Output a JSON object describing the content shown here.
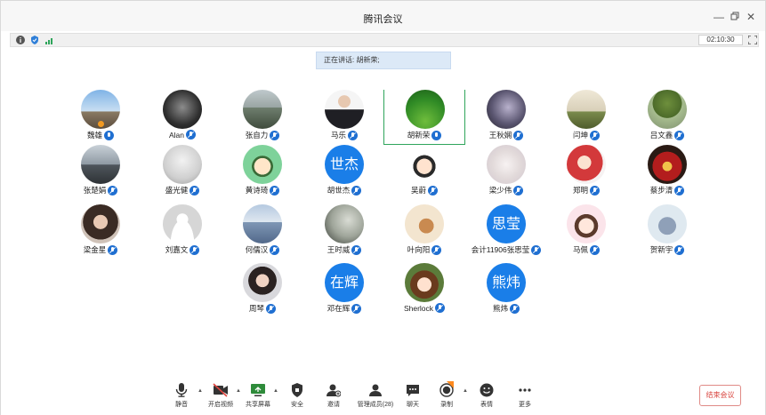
{
  "window": {
    "title": "腾讯会议"
  },
  "status": {
    "timer": "02:10:30"
  },
  "banner": {
    "speaking": "正在讲话: 胡新荣;"
  },
  "participants": [
    {
      "name": "魏雄",
      "avatar": "photo-sky",
      "mic": "on",
      "hand": true
    },
    {
      "name": "Alan",
      "avatar": "photo-dark",
      "mic": "muted"
    },
    {
      "name": "张自力",
      "avatar": "photo-road",
      "mic": "muted"
    },
    {
      "name": "马乐",
      "avatar": "photo-suit",
      "mic": "muted"
    },
    {
      "name": "胡新荣",
      "avatar": "photo-green",
      "mic": "on",
      "active": true
    },
    {
      "name": "王秋娴",
      "avatar": "photo-anime",
      "mic": "muted"
    },
    {
      "name": "闫坤",
      "avatar": "photo-field",
      "mic": "muted"
    },
    {
      "name": "吕文鑫",
      "avatar": "photo-tree",
      "mic": "muted"
    },
    {
      "name": "张楚娟",
      "avatar": "photo-mountain",
      "mic": "muted"
    },
    {
      "name": "盛光健",
      "avatar": "photo-sketch",
      "mic": "muted"
    },
    {
      "name": "黄诗琦",
      "avatar": "photo-cartoon-boy",
      "mic": "muted"
    },
    {
      "name": "胡世杰",
      "avatar": "text",
      "avatar_text": "世杰",
      "mic": "muted"
    },
    {
      "name": "吴蔚",
      "avatar": "photo-cartoon-girl",
      "mic": "muted"
    },
    {
      "name": "梁少伟",
      "avatar": "photo-white-hair",
      "mic": "muted"
    },
    {
      "name": "郑明",
      "avatar": "photo-mermaid",
      "mic": "muted"
    },
    {
      "name": "蔡步清",
      "avatar": "photo-ironman",
      "mic": "muted"
    },
    {
      "name": "梁金星",
      "avatar": "photo-girl",
      "mic": "muted"
    },
    {
      "name": "刘嘉文",
      "avatar": "photo-default",
      "mic": "muted"
    },
    {
      "name": "何儒汉",
      "avatar": "photo-clouds",
      "mic": "muted"
    },
    {
      "name": "王时威",
      "avatar": "photo-ink",
      "mic": "muted"
    },
    {
      "name": "叶向阳",
      "avatar": "photo-jerry",
      "mic": "muted"
    },
    {
      "name": "会计11906张思莹",
      "avatar": "text",
      "avatar_text": "思莹",
      "mic": "muted"
    },
    {
      "name": "马佩",
      "avatar": "photo-pink-girl",
      "mic": "muted"
    },
    {
      "name": "贺新宇",
      "avatar": "photo-tom",
      "mic": "muted"
    },
    {
      "name": "周琴",
      "avatar": "photo-woman",
      "mic": "muted"
    },
    {
      "name": "邓在辉",
      "avatar": "text",
      "avatar_text": "在辉",
      "mic": "muted"
    },
    {
      "name": "Sherlock",
      "avatar": "photo-anime-girl",
      "mic": "muted"
    },
    {
      "name": "熊炜",
      "avatar": "text",
      "avatar_text": "熊炜",
      "mic": "muted"
    }
  ],
  "toolbar": {
    "mute": "静音",
    "video": "开启视频",
    "share": "共享屏幕",
    "security": "安全",
    "invite": "邀请",
    "members": "管理成员(28)",
    "chat": "聊天",
    "record": "录制",
    "reactions": "表情",
    "more": "更多",
    "end": "结束会议"
  },
  "colors": {
    "accent": "#1a7ee8",
    "active_border": "#2fa55b",
    "end_button": "#d9453f"
  }
}
